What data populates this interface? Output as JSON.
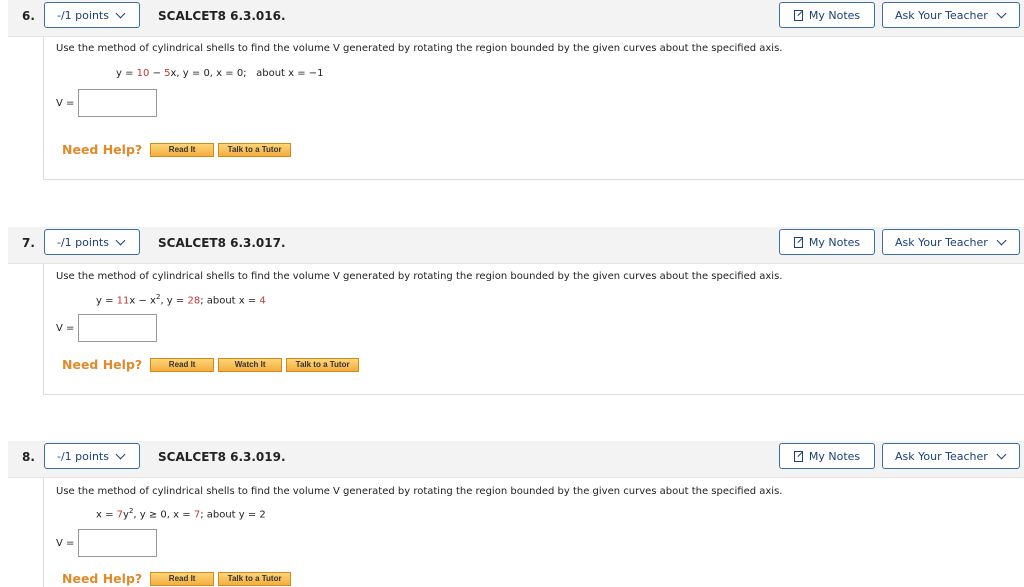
{
  "questions": [
    {
      "number": "6.",
      "points": "-/1 points",
      "id": "SCALCET8 6.3.016.",
      "my_notes": "My Notes",
      "ask_teacher": "Ask Your Teacher",
      "prompt": "Use the method of cylindrical shells to find the volume V generated by rotating the region bounded by the given curves about the specified axis.",
      "equation": {
        "p1": "y = ",
        "r1": "10",
        "p2": " − ",
        "r2": "5",
        "p3": "x,  y = 0,  x = 0;",
        "p4": "about x = −1"
      },
      "answer_label": "V =",
      "need_help": "Need Help?",
      "help_buttons": [
        "Read It",
        "Talk to a Tutor"
      ]
    },
    {
      "number": "7.",
      "points": "-/1 points",
      "id": "SCALCET8 6.3.017.",
      "my_notes": "My Notes",
      "ask_teacher": "Ask Your Teacher",
      "prompt": "Use the method of cylindrical shells to find the volume V generated by rotating the region bounded by the given curves about the specified axis.",
      "equation": {
        "p1": "y = ",
        "r1": "11",
        "p2": "x − x",
        "sup": "2",
        "p3": ", y = ",
        "r2": "28",
        "p4": ";   about x = ",
        "r3": "4"
      },
      "answer_label": "V =",
      "need_help": "Need Help?",
      "help_buttons": [
        "Read It",
        "Watch It",
        "Talk to a Tutor"
      ]
    },
    {
      "number": "8.",
      "points": "-/1 points",
      "id": "SCALCET8 6.3.019.",
      "my_notes": "My Notes",
      "ask_teacher": "Ask Your Teacher",
      "prompt": "Use the method of cylindrical shells to find the volume V generated by rotating the region bounded by the given curves about the specified axis.",
      "equation": {
        "p1": "x = ",
        "r1": "7",
        "p2": "y",
        "sup": "2",
        "p3": ", y ≥ 0, x = ",
        "r2": "7",
        "p4": ";   about y = 2"
      },
      "answer_label": "V =",
      "need_help": "Need Help?",
      "help_buttons": [
        "Read It",
        "Talk to a Tutor"
      ]
    }
  ],
  "colors": {
    "accent": "#1d3f73",
    "highlight": "#c2382f",
    "help": "#e08a2a"
  },
  "icons": [
    "chevron-down-icon",
    "note-icon"
  ]
}
